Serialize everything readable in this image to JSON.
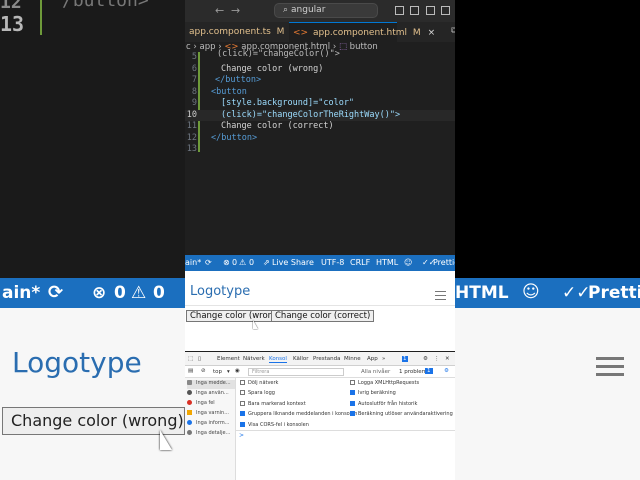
{
  "background": {
    "line_number": "13",
    "line_number_above": "12",
    "code_fragment": "/button>",
    "status_branch": "ain*",
    "status_sync_icon": "sync-icon",
    "status_errors": "0",
    "status_warnings": "0",
    "status_html": "HTML",
    "status_prettier": "Prettier",
    "logo": "Logotype",
    "button": "Change color (wrong)"
  },
  "editor": {
    "search": "angular",
    "tabs": [
      {
        "label": "app.component.ts",
        "badge": "M"
      },
      {
        "label": "app.component.html",
        "badge": "M",
        "close": "×"
      }
    ],
    "breadcrumb": {
      "part0": "c",
      "part1": "app",
      "part2": "app.component.html",
      "part3": "button"
    },
    "lines": [
      {
        "n": "5",
        "code": "(click)=\"changeColor()\">"
      },
      {
        "n": "6",
        "code": "Change color (wrong)"
      },
      {
        "n": "7",
        "code": "</button>"
      },
      {
        "n": "8",
        "code": "<button"
      },
      {
        "n": "9",
        "code": "[style.background]=\"color\""
      },
      {
        "n": "10",
        "code": "(click)=\"changeColorTheRightWay()\">"
      },
      {
        "n": "11",
        "code": "Change color (correct)"
      },
      {
        "n": "12",
        "code": "</button>"
      },
      {
        "n": "13",
        "code": ""
      }
    ]
  },
  "statusbar": {
    "branch": "ain*",
    "errors": "0",
    "warnings": "0",
    "live_share": "Live Share",
    "encoding": "UTF-8",
    "eol": "CRLF",
    "language": "HTML",
    "prettier": "Prettier"
  },
  "app": {
    "logo": "Logotype",
    "btn_wrong": "Change color (wrong)",
    "btn_correct": "Change color (correct)"
  },
  "devtools": {
    "tabs": [
      "Element",
      "Nätverk",
      "Konsol",
      "Källor",
      "Prestanda",
      "Minne",
      "App"
    ],
    "badge": "1",
    "context": "top",
    "filter_placeholder": "Filtrera",
    "levels": "Alla nivåer",
    "issues": "1 problem:",
    "issues_count": "1",
    "sidebar": [
      "Inga medde...",
      "Inga använ...",
      "Inga fel",
      "Inga varnin...",
      "Inga inform...",
      "Inga detalje..."
    ],
    "options_left": [
      {
        "label": "Dölj nätverk",
        "checked": false
      },
      {
        "label": "Spara logg",
        "checked": false
      },
      {
        "label": "Bara markerad kontext",
        "checked": false
      },
      {
        "label": "Gruppera liknande meddelanden i konsolen",
        "checked": true
      },
      {
        "label": "Visa CORS-fel i konsolen",
        "checked": true
      }
    ],
    "options_right": [
      {
        "label": "Logga XMLHttpRequests",
        "checked": false
      },
      {
        "label": "Ivrig beräkning",
        "checked": true
      },
      {
        "label": "Autoslutför från historik",
        "checked": true
      },
      {
        "label": "Beräkning utlöser användaraktivering",
        "checked": true
      }
    ],
    "prompt": ">"
  },
  "colors": {
    "statusbar": "#1b6fbf",
    "logo": "#2a6db0",
    "accent": "#0078d4"
  }
}
